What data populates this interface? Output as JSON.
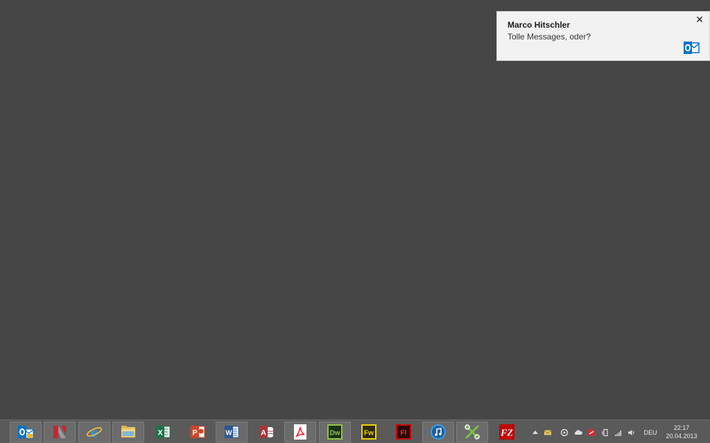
{
  "notification": {
    "title": "Marco Hitschler",
    "message": "Tolle Messages, oder?",
    "close_glyph": "✕",
    "app_icon": "outlook-icon"
  },
  "taskbar": {
    "apps": [
      {
        "name": "Outlook",
        "icon": "outlook-icon",
        "label": "O",
        "color": "#0072c6",
        "running": true
      },
      {
        "name": "App",
        "icon": "red-ribbon-icon",
        "label": "",
        "color": "#c8272d",
        "running": true
      },
      {
        "name": "Internet Explorer",
        "icon": "internet-explorer-icon",
        "label": "e",
        "color": "#2b9de8",
        "running": true
      },
      {
        "name": "File Explorer",
        "icon": "folder-icon",
        "label": "",
        "color": "#e8c866",
        "running": true
      },
      {
        "name": "Excel",
        "icon": "excel-icon",
        "label": "X",
        "color": "#1e7145",
        "running": false
      },
      {
        "name": "PowerPoint",
        "icon": "powerpoint-icon",
        "label": "P",
        "color": "#d04525",
        "running": false
      },
      {
        "name": "Word",
        "icon": "word-icon",
        "label": "W",
        "color": "#2b579a",
        "running": true
      },
      {
        "name": "Access",
        "icon": "access-icon",
        "label": "A",
        "color": "#a4373a",
        "running": false
      },
      {
        "name": "Acrobat",
        "icon": "acrobat-icon",
        "label": "",
        "color": "#e5252a",
        "running": true
      },
      {
        "name": "Dreamweaver",
        "icon": "dreamweaver-icon",
        "label": "Dw",
        "color": "#8ec63f",
        "running": true
      },
      {
        "name": "Fireworks",
        "icon": "fireworks-icon",
        "label": "Fw",
        "color": "#f2d300",
        "running": false
      },
      {
        "name": "Flash",
        "icon": "flash-icon",
        "label": "Fl",
        "color": "#cc0000",
        "running": false
      },
      {
        "name": "iTunes",
        "icon": "itunes-icon",
        "label": "",
        "color": "#3aa0e6",
        "running": true
      },
      {
        "name": "Tool",
        "icon": "tools-icon",
        "label": "",
        "color": "#7bc043",
        "running": true
      },
      {
        "name": "FileZilla",
        "icon": "filezilla-icon",
        "label": "FZ",
        "color": "#bf0000",
        "running": false
      }
    ]
  },
  "tray": {
    "icons": [
      "show-hidden-icons-icon",
      "mail-icon",
      "sync-icon",
      "cloud-icon",
      "red-app-icon",
      "device-icon",
      "signal-icon",
      "volume-icon"
    ],
    "language": "DEU",
    "time": "22:17",
    "date": "20.04.2013"
  }
}
